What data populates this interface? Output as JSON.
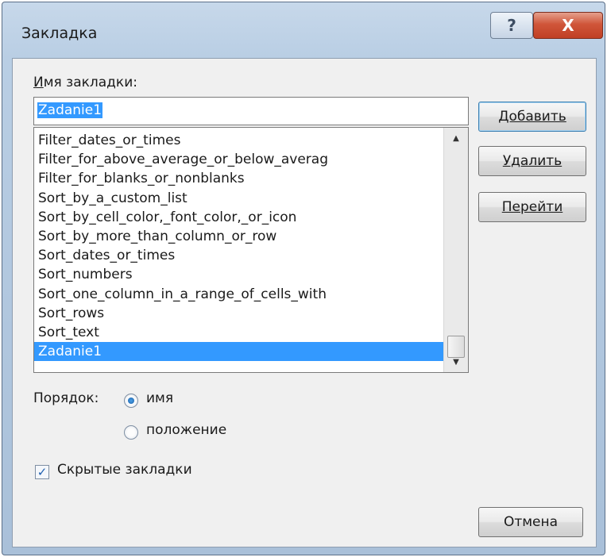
{
  "window": {
    "title": "Закладка",
    "help_icon": "?",
    "close_icon": "X"
  },
  "bookmark_name": {
    "label": "Имя закладки:",
    "value": "Zadanie1"
  },
  "bookmark_list": {
    "items": [
      "Filter_dates_or_times",
      "Filter_for_above_average_or_below_averag",
      "Filter_for_blanks_or_nonblanks",
      "Sort_by_a_custom_list",
      "Sort_by_cell_color,_font_color,_or_icon",
      "Sort_by_more_than_column_or_row",
      "Sort_dates_or_times",
      "Sort_numbers",
      "Sort_one_column_in_a_range_of_cells_with",
      "Sort_rows",
      "Sort_text",
      "Zadanie1"
    ],
    "selected": "Zadanie1"
  },
  "buttons": {
    "add": "Добавить",
    "delete": "Удалить",
    "goto": "Перейти",
    "cancel": "Отмена"
  },
  "sort": {
    "label": "Порядок:",
    "options": [
      "имя",
      "положение"
    ],
    "selected": "имя"
  },
  "hidden_bookmarks": {
    "label": "Скрытые закладки",
    "checked": true
  },
  "colors": {
    "selection": "#3399ff",
    "close_button": "#c03f24",
    "titlebar": "#b9cee4",
    "dialog_body": "#f0f0f0"
  },
  "icons": {
    "help": "help-icon",
    "close": "close-icon",
    "scroll_up": "chevron-up-icon",
    "scroll_down": "chevron-down-icon",
    "check": "checkmark-icon"
  }
}
